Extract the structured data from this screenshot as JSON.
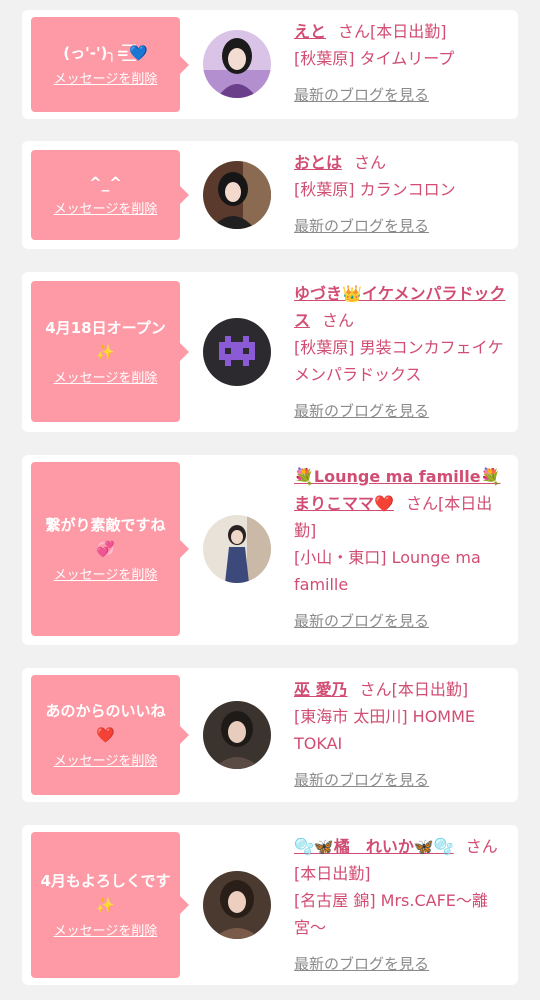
{
  "cards": [
    {
      "message": "(っ'-')╮=͟͟͞͞💙",
      "delete_label": "メッセージを削除",
      "name": "えと",
      "san": "さん",
      "tag": "[本日出勤]",
      "shop": "[秋葉原] タイムリープ",
      "blog_label": "最新のブログを見る",
      "avatar_icon": "avatar-photo"
    },
    {
      "message": "^_^",
      "delete_label": "メッセージを削除",
      "name": "おとは",
      "san": "さん",
      "tag": "",
      "shop": "[秋葉原] カランコロン",
      "blog_label": "最新のブログを見る",
      "avatar_icon": "avatar-photo"
    },
    {
      "message": "4月18日オープン✨",
      "delete_label": "メッセージを削除",
      "name": "ゆづき👑イケメンパラドックス",
      "san": "さん",
      "tag": "",
      "shop": "[秋葉原] 男装コンカフェイケメンパラドックス",
      "blog_label": "最新のブログを見る",
      "avatar_icon": "avatar-pixel-invader"
    },
    {
      "message": "繋がり素敵ですね💞",
      "delete_label": "メッセージを削除",
      "name": "💐Lounge ma famille💐まりこママ❤️",
      "san": "さん",
      "tag": "[本日出勤]",
      "shop": "[小山・東口] Lounge ma famille",
      "blog_label": "最新のブログを見る",
      "avatar_icon": "avatar-photo"
    },
    {
      "message": "あのからのいいね❤️",
      "delete_label": "メッセージを削除",
      "name": "巫 愛乃",
      "san": "さん",
      "tag": "[本日出勤]",
      "shop": "[東海市 太田川] HOMME TOKAI",
      "blog_label": "最新のブログを見る",
      "avatar_icon": "avatar-photo"
    },
    {
      "message": "4月もよろしくです✨",
      "delete_label": "メッセージを削除",
      "name": "🫧🦋橘　れいか🦋🫧",
      "san": "さん",
      "tag": "[本日出勤]",
      "shop": "[名古屋 錦] Mrs.CAFE〜離宮〜",
      "blog_label": "最新のブログを見る",
      "avatar_icon": "avatar-photo"
    }
  ],
  "colors": {
    "bubble": "#fe9aa6",
    "name": "#d14d73",
    "background": "#f1f1f1",
    "blog_link": "#8a8a8a"
  }
}
